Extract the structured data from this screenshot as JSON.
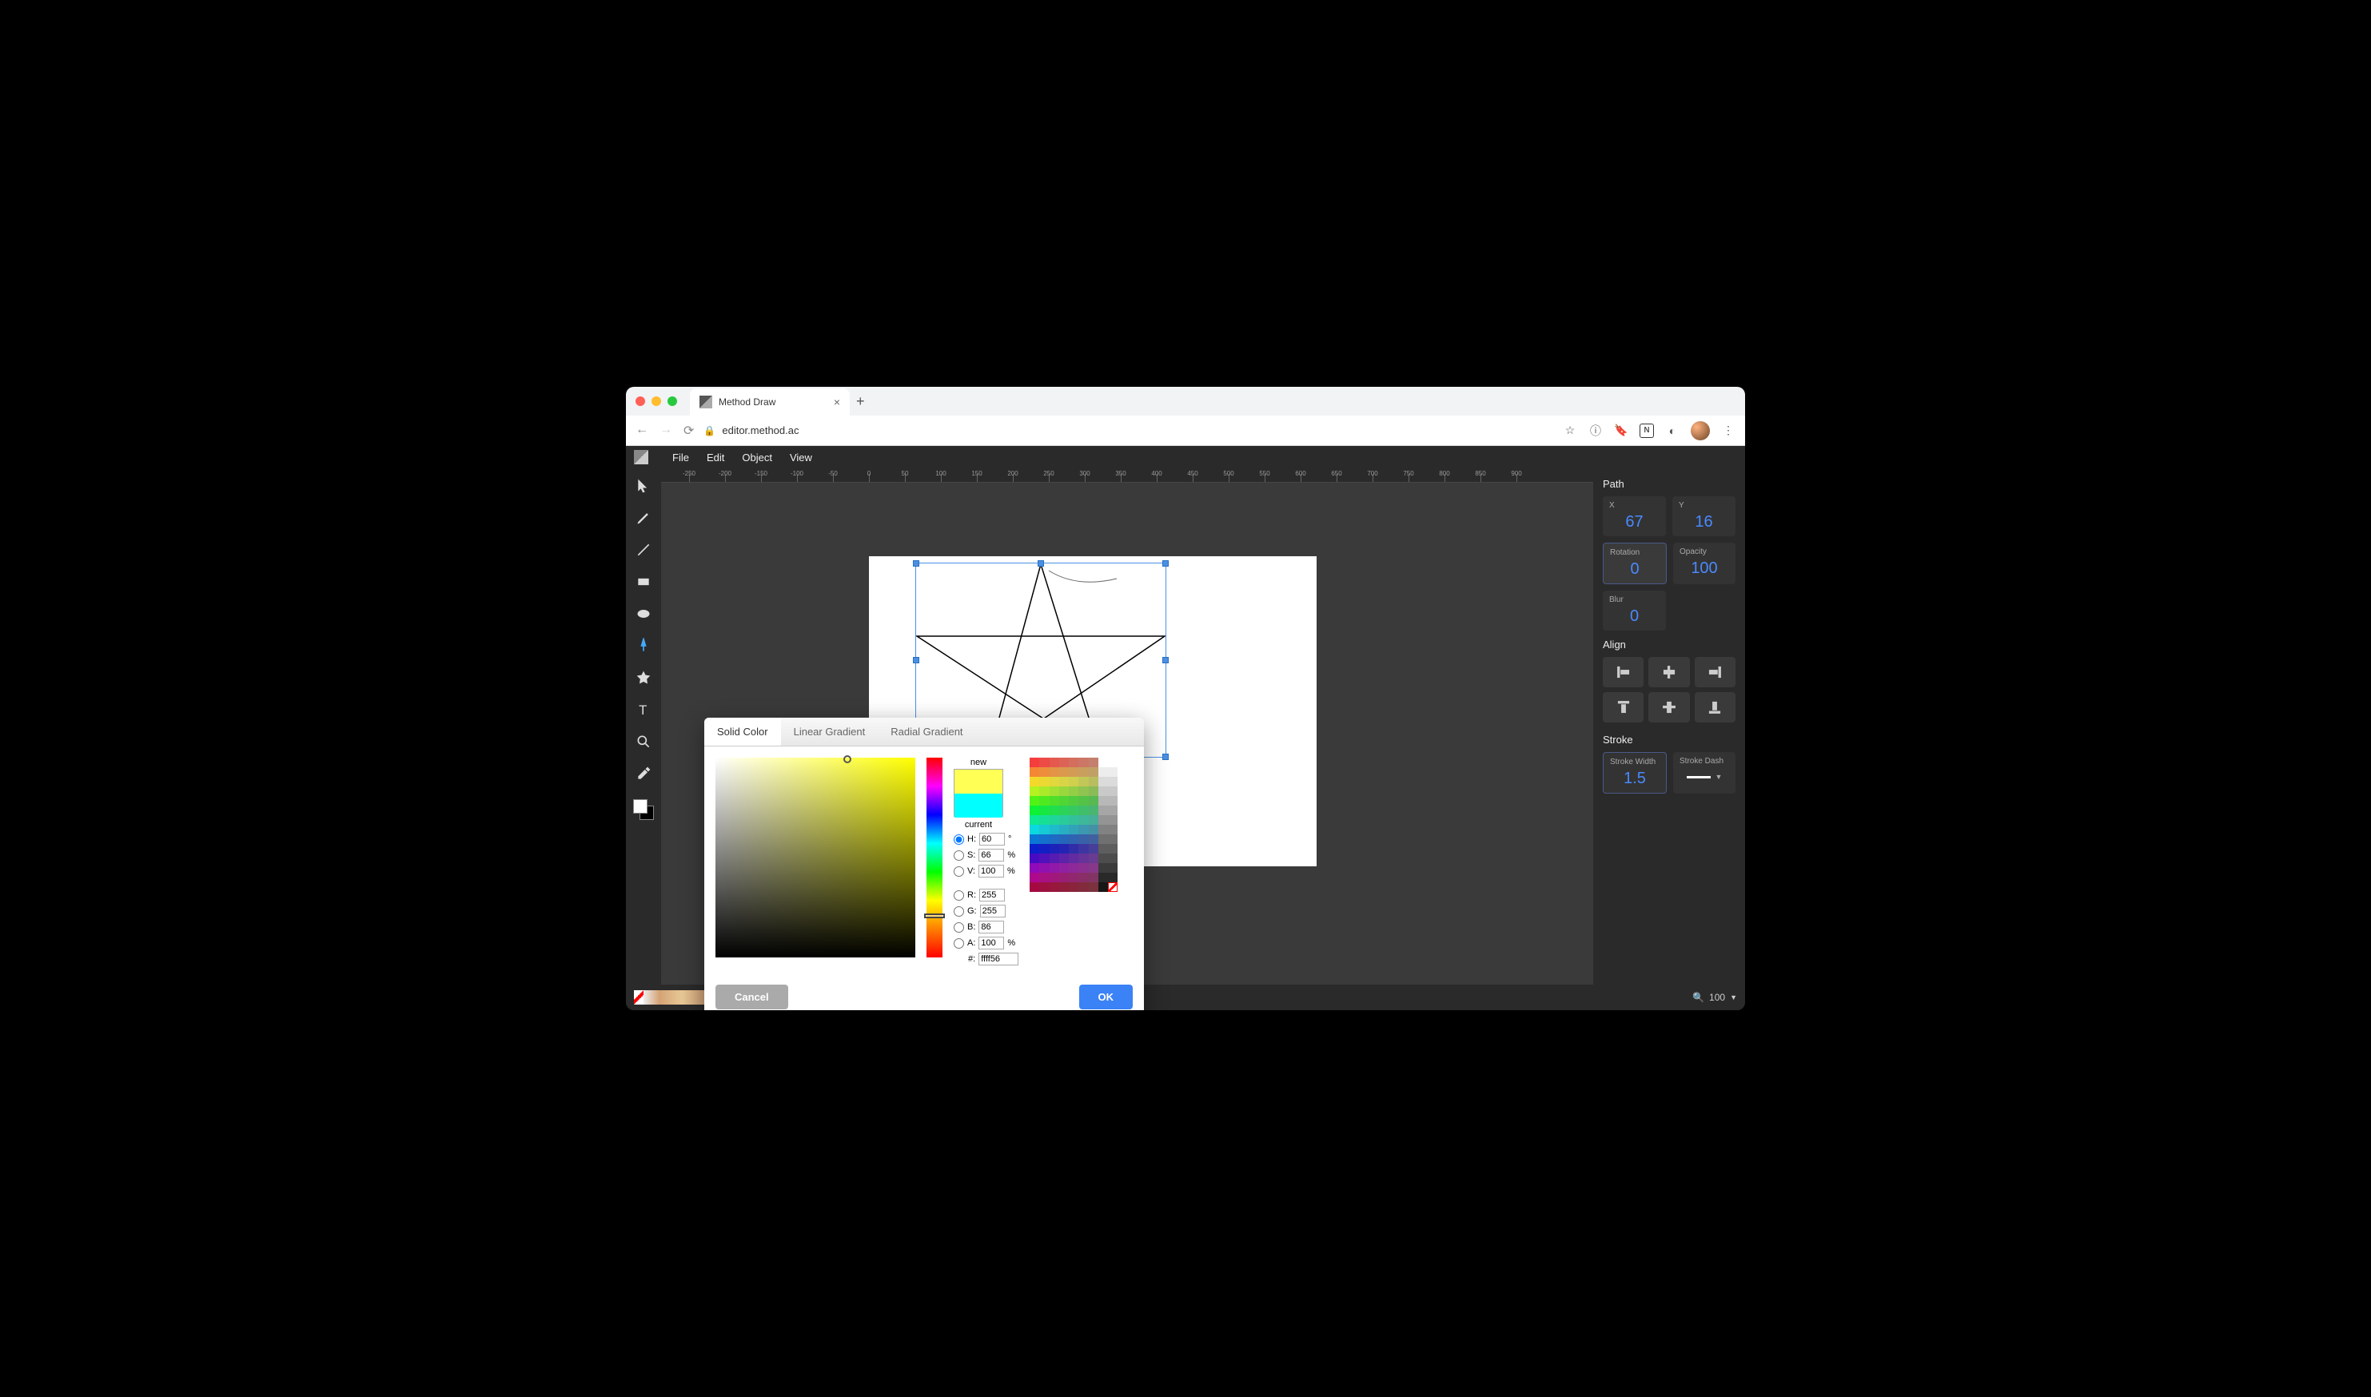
{
  "browser": {
    "tab_title": "Method Draw",
    "url": "editor.method.ac"
  },
  "menu": {
    "file": "File",
    "edit": "Edit",
    "object": "Object",
    "view": "View"
  },
  "panel": {
    "path_title": "Path",
    "x_label": "X",
    "x_val": "67",
    "y_label": "Y",
    "y_val": "16",
    "rotation_label": "Rotation",
    "rotation_val": "0",
    "opacity_label": "Opacity",
    "opacity_val": "100",
    "blur_label": "Blur",
    "blur_val": "0",
    "align_title": "Align",
    "stroke_title": "Stroke",
    "stroke_width_label": "Stroke Width",
    "stroke_width_val": "1.5",
    "stroke_dash_label": "Stroke Dash"
  },
  "zoom": {
    "value": "100"
  },
  "picker": {
    "tab_solid": "Solid Color",
    "tab_linear": "Linear Gradient",
    "tab_radial": "Radial Gradient",
    "new_label": "new",
    "current_label": "current",
    "new_color": "#ffff56",
    "current_color": "#00ffff",
    "h_label": "H:",
    "h_val": "60",
    "h_unit": "°",
    "s_label": "S:",
    "s_val": "66",
    "s_unit": "%",
    "v_label": "V:",
    "v_val": "100",
    "v_unit": "%",
    "r_label": "R:",
    "r_val": "255",
    "g_label": "G:",
    "g_val": "255",
    "b_label": "B:",
    "b_val": "86",
    "a_label": "A:",
    "a_val": "100",
    "a_unit": "%",
    "hex_label": "#:",
    "hex_val": "ffff56",
    "cancel": "Cancel",
    "ok": "OK"
  }
}
